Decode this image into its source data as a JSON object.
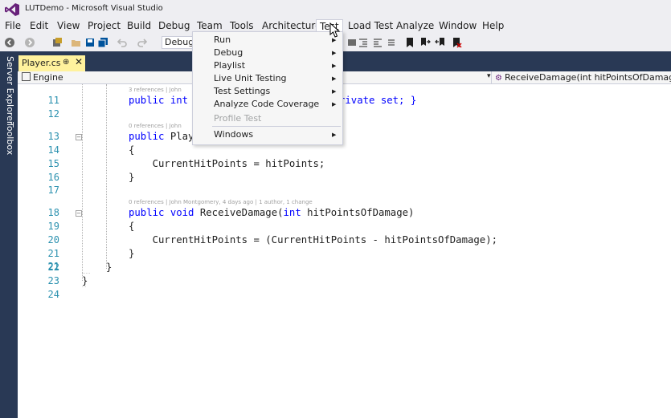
{
  "window": {
    "title": "LUTDemo - Microsoft Visual Studio"
  },
  "menubar": {
    "items": [
      "File",
      "Edit",
      "View",
      "Project",
      "Build",
      "Debug",
      "Team",
      "Tools",
      "Architecture",
      "Test",
      "Load Test",
      "Analyze",
      "Window",
      "Help"
    ],
    "active": "Test"
  },
  "toolbar": {
    "configuration": "Debug"
  },
  "tabs": [
    {
      "label": "Player.cs",
      "pin": "⊕",
      "close": "✕"
    }
  ],
  "sidebar": {
    "tabs": [
      "Server Explorer",
      "Toolbox"
    ]
  },
  "navbar": {
    "left": "Engine",
    "right": "ReceiveDamage(int hitPointsOfDamage)"
  },
  "code": {
    "line_numbers": [
      "11",
      "12",
      "13",
      "14",
      "15",
      "16",
      "17",
      "18",
      "19",
      "20",
      "21",
      "22",
      "23",
      "24"
    ],
    "lens": {
      "a": "3 references | John",
      "b": "0 references | John",
      "c": "0 references | John Montgomery, 4 days ago | 1 author, 1 change"
    },
    "l11a": "public ",
    "l11b": "int",
    "l11c": "rivate set; }",
    "l13a": "public ",
    "l13b": "Play",
    "l14": "{",
    "l15": "    CurrentHitPoints = hitPoints;",
    "l16": "}",
    "l18a": "public ",
    "l18b": "void",
    "l18c": " ReceiveDamage(",
    "l18d": "int",
    "l18e": " hitPointsOfDamage)",
    "l19": "{",
    "l20": "    CurrentHitPoints = (CurrentHitPoints - hitPointsOfDamage);",
    "l21": "}",
    "l22": "}",
    "l23": "}"
  },
  "test_menu": {
    "items": [
      {
        "label": "Run",
        "submenu": true,
        "enabled": true
      },
      {
        "label": "Debug",
        "submenu": true,
        "enabled": true
      },
      {
        "label": "Playlist",
        "submenu": true,
        "enabled": true
      },
      {
        "label": "Live Unit Testing",
        "submenu": true,
        "enabled": true
      },
      {
        "label": "Test Settings",
        "submenu": true,
        "enabled": true
      },
      {
        "label": "Analyze Code Coverage",
        "submenu": true,
        "enabled": true
      },
      {
        "label": "Profile Test",
        "submenu": false,
        "enabled": false
      },
      {
        "label": "Windows",
        "submenu": true,
        "enabled": true
      }
    ]
  },
  "colors": {
    "accent": "#68217a",
    "tab_active": "#fff29d",
    "chrome": "#eeeef2",
    "dark": "#293955",
    "keyword": "#0000ff",
    "line_number": "#2b91af"
  }
}
